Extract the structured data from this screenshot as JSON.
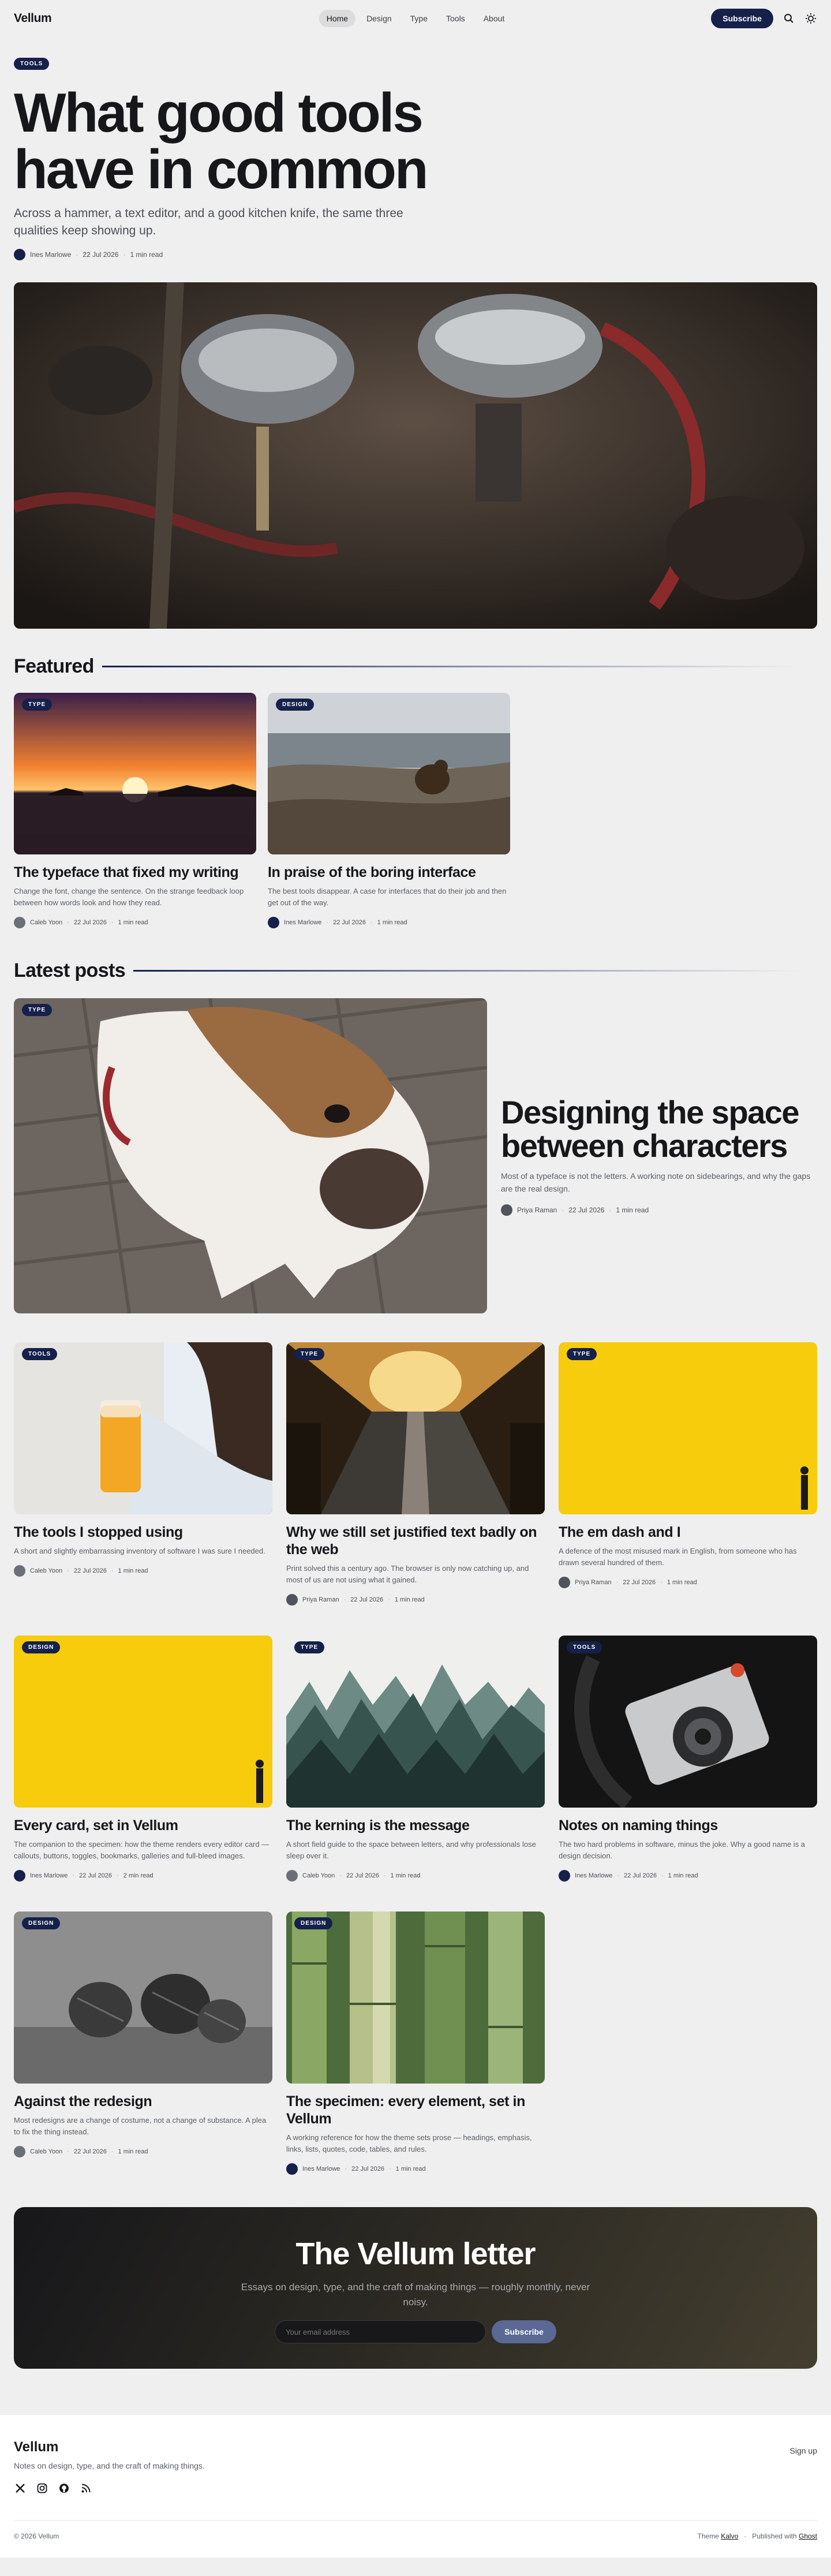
{
  "nav": {
    "logo": "Vellum",
    "items": [
      {
        "label": "Home",
        "active": true
      },
      {
        "label": "Design",
        "active": false
      },
      {
        "label": "Type",
        "active": false
      },
      {
        "label": "Tools",
        "active": false
      },
      {
        "label": "About",
        "active": false
      }
    ],
    "subscribe_label": "Subscribe",
    "icons": [
      "search-icon",
      "theme-toggle-icon"
    ]
  },
  "hero": {
    "tag": "TOOLS",
    "title": "What good tools have in common",
    "dek": "Across a hammer, a text editor, and a good kitchen knife, the same three qualities keep showing up.",
    "author": "Ines Marlowe",
    "date": "22 Jul 2026",
    "read": "1 min read"
  },
  "featured": {
    "heading": "Featured",
    "posts": [
      {
        "tag": "TYPE",
        "title": "The typeface that fixed my writing",
        "excerpt": "Change the font, change the sentence. On the strange feedback loop between how words look and how they read.",
        "author": "Caleb Yoon",
        "date": "22 Jul 2026",
        "read": "1 min read"
      },
      {
        "tag": "DESIGN",
        "title": "In praise of the boring interface",
        "excerpt": "The best tools disappear. A case for interfaces that do their job and then get out of the way.",
        "author": "Ines Marlowe",
        "date": "22 Jul 2026",
        "read": "1 min read"
      }
    ]
  },
  "latest": {
    "heading": "Latest posts",
    "big": {
      "tag": "TYPE",
      "title": "Designing the space between characters",
      "excerpt": "Most of a typeface is not the letters. A working note on sidebearings, and why the gaps are the real design.",
      "author": "Priya Raman",
      "date": "22 Jul 2026",
      "read": "1 min read"
    },
    "posts": [
      {
        "tag": "TOOLS",
        "title": "The tools I stopped using",
        "excerpt": "A short and slightly embarrassing inventory of software I was sure I needed.",
        "author": "Caleb Yoon",
        "date": "22 Jul 2026",
        "read": "1 min read"
      },
      {
        "tag": "TYPE",
        "title": "Why we still set justified text badly on the web",
        "excerpt": "Print solved this a century ago. The browser is only now catching up, and most of us are not using what it gained.",
        "author": "Priya Raman",
        "date": "22 Jul 2026",
        "read": "1 min read"
      },
      {
        "tag": "TYPE",
        "title": "The em dash and I",
        "excerpt": "A defence of the most misused mark in English, from someone who has drawn several hundred of them.",
        "author": "Priya Raman",
        "date": "22 Jul 2026",
        "read": "1 min read"
      },
      {
        "tag": "DESIGN",
        "title": "Every card, set in Vellum",
        "excerpt": "The companion to the specimen: how the theme renders every editor card — callouts, buttons, toggles, bookmarks, galleries and full-bleed images.",
        "author": "Ines Marlowe",
        "date": "22 Jul 2026",
        "read": "2 min read"
      },
      {
        "tag": "TYPE",
        "title": "The kerning is the message",
        "excerpt": "A short field guide to the space between letters, and why professionals lose sleep over it.",
        "author": "Caleb Yoon",
        "date": "22 Jul 2026",
        "read": "1 min read"
      },
      {
        "tag": "TOOLS",
        "title": "Notes on naming things",
        "excerpt": "The two hard problems in software, minus the joke. Why a good name is a design decision.",
        "author": "Ines Marlowe",
        "date": "22 Jul 2026",
        "read": "1 min read"
      },
      {
        "tag": "DESIGN",
        "title": "Against the redesign",
        "excerpt": "Most redesigns are a change of costume, not a change of substance. A plea to fix the thing instead.",
        "author": "Caleb Yoon",
        "date": "22 Jul 2026",
        "read": "1 min read"
      },
      {
        "tag": "DESIGN",
        "title": "The specimen: every element, set in Vellum",
        "excerpt": "A working reference for how the theme sets prose — headings, emphasis, links, lists, quotes, code, tables, and rules.",
        "author": "Ines Marlowe",
        "date": "22 Jul 2026",
        "read": "1 min read"
      }
    ]
  },
  "newsletter": {
    "title": "The Vellum letter",
    "text": "Essays on design, type, and the craft of making things — roughly monthly, never noisy.",
    "placeholder": "Your email address",
    "button": "Subscribe"
  },
  "footer": {
    "logo": "Vellum",
    "desc": "Notes on design, type, and the craft of making things.",
    "signup": "Sign up",
    "social": [
      "x-icon",
      "instagram-icon",
      "github-icon",
      "rss-icon"
    ],
    "copyright": "© 2026 Vellum",
    "theme_prefix": "Theme",
    "theme_name": "Kalvo",
    "published_prefix": "Published with",
    "published_name": "Ghost"
  },
  "colors": {
    "accent": "#15214a",
    "page_bg": "#efefef"
  }
}
